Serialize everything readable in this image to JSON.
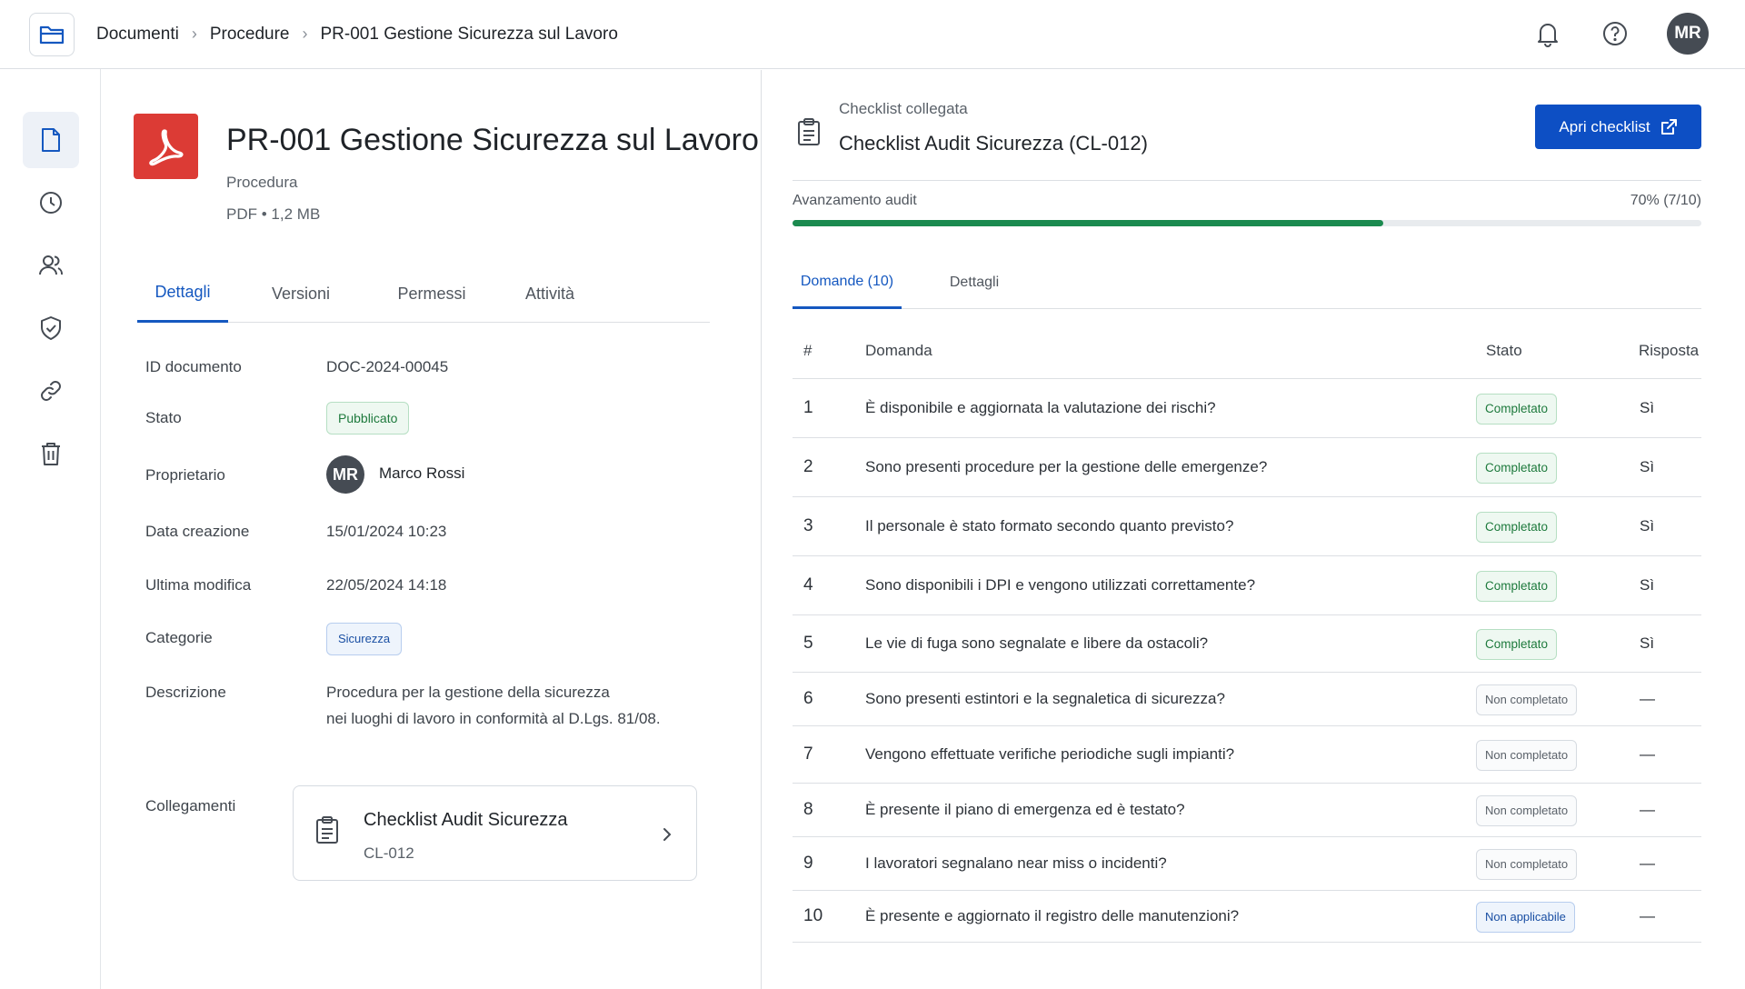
{
  "breadcrumb": {
    "items": [
      "Documenti",
      "Procedure",
      "PR-001 Gestione Sicurezza sul Lavoro"
    ]
  },
  "user": {
    "initials": "MR"
  },
  "icons": {
    "folder": "folder-icon",
    "bell": "bell-icon",
    "help": "help-icon",
    "rail": [
      "document-icon",
      "clock-icon",
      "users-icon",
      "shield-icon",
      "link-icon",
      "trash-icon"
    ]
  },
  "colors": {
    "accent": "#1558c0",
    "primary_button": "#0d4fc4",
    "pdf": "#dc3b35",
    "success": "#1b8a4f"
  },
  "document": {
    "title": "PR-001 Gestione Sicurezza sul Lavoro",
    "type": "Procedura",
    "format": "PDF",
    "size": "1,2 MB",
    "tabs": [
      "Dettagli",
      "Versioni",
      "Permessi",
      "Attività"
    ],
    "active_tab": "Dettagli",
    "fields": {
      "id_label": "ID documento",
      "id_value": "DOC-2024-00045",
      "status_label": "Stato",
      "status_value": "Pubblicato",
      "owner_label": "Proprietario",
      "owner_initials": "MR",
      "owner_name": "Marco Rossi",
      "created_label": "Data creazione",
      "created_value": "15/01/2024 10:23",
      "modified_label": "Ultima modifica",
      "modified_value": "22/05/2024 14:18",
      "category_label": "Categorie",
      "category_value": "Sicurezza",
      "description_label": "Descrizione",
      "description_line1": "Procedura per la gestione della sicurezza",
      "description_line2": "nei luoghi di lavoro in conformità al D.Lgs. 81/08.",
      "links_label": "Collegamenti"
    },
    "link_card": {
      "title": "Checklist Audit Sicurezza",
      "code": "CL-012"
    }
  },
  "checklist": {
    "caption": "Checklist collegata",
    "title": "Checklist Audit Sicurezza (CL-012)",
    "open_button": "Apri checklist",
    "progress_label": "Avanzamento audit",
    "progress_text": "70% (7/10)",
    "progress_fraction": 0.65,
    "tabs": [
      "Domande (10)",
      "Dettagli"
    ],
    "active_tab": "Domande (10)",
    "columns": [
      "#",
      "Domanda",
      "Stato",
      "Risposta"
    ],
    "rows": [
      {
        "num": "1",
        "question": "È disponibile e aggiornata la valutazione dei rischi?",
        "status": "Completato",
        "kind": "done",
        "answer": "Sì"
      },
      {
        "num": "2",
        "question": "Sono presenti procedure per la gestione delle emergenze?",
        "status": "Completato",
        "kind": "done",
        "answer": "Sì"
      },
      {
        "num": "3",
        "question": "Il personale è stato formato secondo quanto previsto?",
        "status": "Completato",
        "kind": "done",
        "answer": "Sì"
      },
      {
        "num": "4",
        "question": "Sono disponibili i DPI e vengono utilizzati correttamente?",
        "status": "Completato",
        "kind": "done",
        "answer": "Sì"
      },
      {
        "num": "5",
        "question": "Le vie di fuga sono segnalate e libere da ostacoli?",
        "status": "Completato",
        "kind": "done",
        "answer": "Sì"
      },
      {
        "num": "6",
        "question": "Sono presenti estintori e la segnaletica di sicurezza?",
        "status": "Non completato",
        "kind": "todo",
        "answer": "—"
      },
      {
        "num": "7",
        "question": "Vengono effettuate verifiche periodiche sugli impianti?",
        "status": "Non completato",
        "kind": "todo",
        "answer": "—"
      },
      {
        "num": "8",
        "question": "È presente il piano di emergenza ed è testato?",
        "status": "Non completato",
        "kind": "todo",
        "answer": "—"
      },
      {
        "num": "9",
        "question": "I lavoratori segnalano near miss o incidenti?",
        "status": "Non completato",
        "kind": "todo",
        "answer": "—"
      },
      {
        "num": "10",
        "question": "È presente e aggiornato il registro delle manutenzioni?",
        "status": "Non applicabile",
        "kind": "na",
        "answer": "—"
      }
    ]
  }
}
